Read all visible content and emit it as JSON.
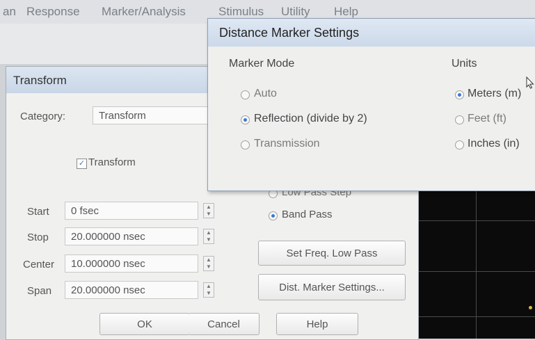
{
  "menubar": {
    "items": [
      "an",
      "Response",
      "Marker/Analysis",
      "Stimulus",
      "Utility",
      "Help"
    ]
  },
  "colors": {
    "accent": "#3a79d6",
    "title_bar": "#d3deeb",
    "background": "#f0f0ef",
    "screen": "#0b0b0b"
  },
  "transform_dialog": {
    "title": "Transform",
    "category_label": "Category:",
    "category_value": "Transform",
    "transform_checkbox": {
      "label": "Transform",
      "checked": true
    },
    "fields": [
      {
        "label": "Start",
        "value": "0 fsec"
      },
      {
        "label": "Stop",
        "value": "20.000000 nsec"
      },
      {
        "label": "Center",
        "value": "10.000000 nsec"
      },
      {
        "label": "Span",
        "value": "20.000000 nsec"
      }
    ],
    "mode_options": [
      {
        "label": "Low Pass Step",
        "selected": false
      },
      {
        "label": "Band Pass",
        "selected": true
      }
    ],
    "set_freq_button": "Set Freq. Low Pass",
    "dist_marker_button": "Dist. Marker Settings...",
    "ok_button": "OK",
    "cancel_button": "Cancel",
    "help_button": "Help"
  },
  "distance_marker_dialog": {
    "title": "Distance Marker Settings",
    "marker_mode_label": "Marker Mode",
    "marker_modes": [
      {
        "label": "Auto",
        "selected": false
      },
      {
        "label": "Reflection (divide by 2)",
        "selected": true
      },
      {
        "label": "Transmission",
        "selected": false
      }
    ],
    "units_label": "Units",
    "units": [
      {
        "label": "Meters (m)",
        "selected": true
      },
      {
        "label": "Feet (ft)",
        "selected": false
      },
      {
        "label": "Inches (in)",
        "selected": false
      }
    ]
  }
}
